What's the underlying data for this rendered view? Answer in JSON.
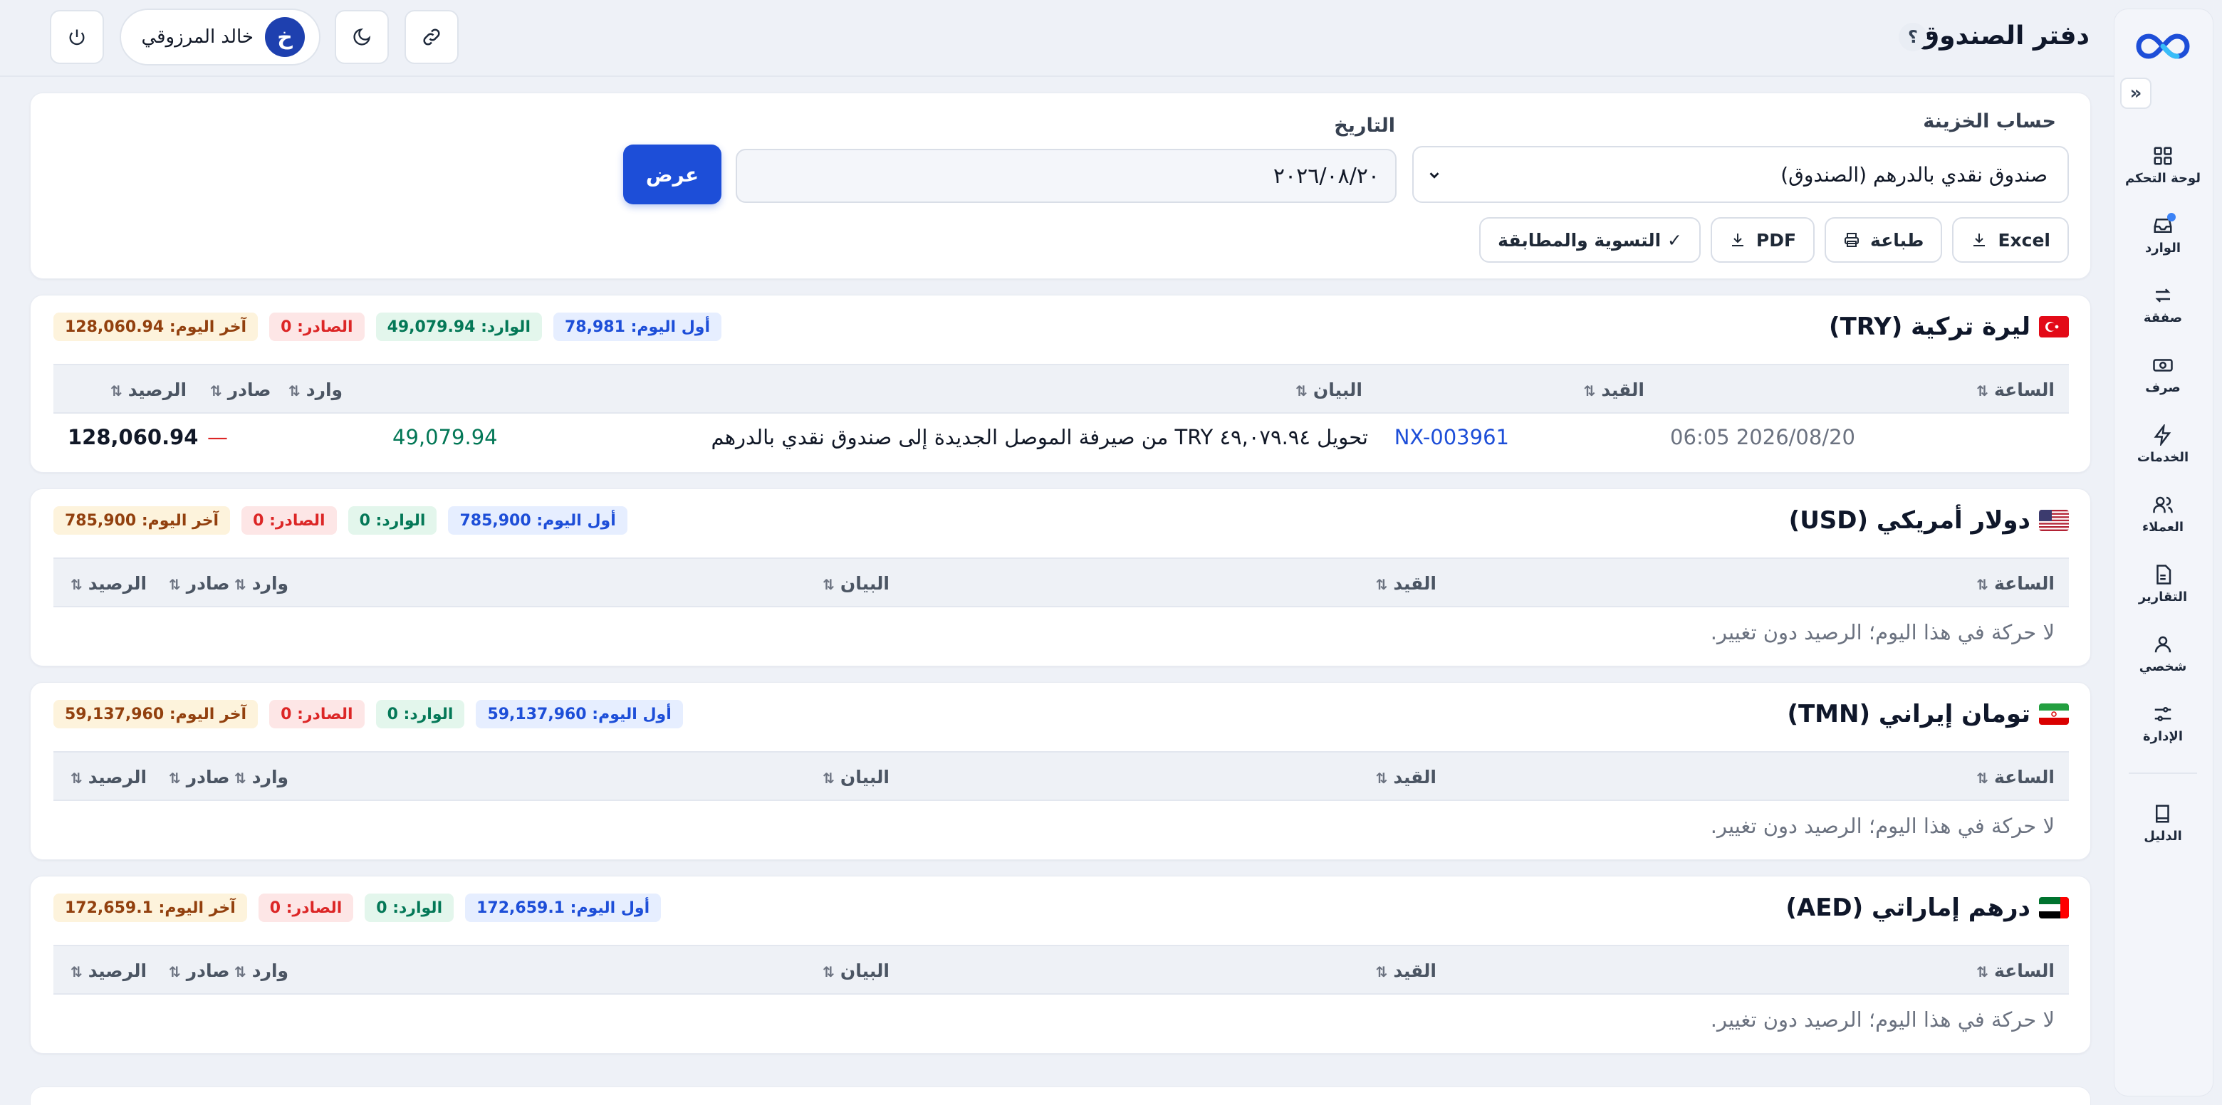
{
  "sidebar": {
    "items": [
      {
        "label": "لوحة التحكم",
        "icon": "dashboard-icon"
      },
      {
        "label": "الوارد",
        "icon": "inbox-icon"
      },
      {
        "label": "صفقة",
        "icon": "transfer-icon"
      },
      {
        "label": "صرف",
        "icon": "cash-icon"
      },
      {
        "label": "الخدمات",
        "icon": "bolt-icon"
      },
      {
        "label": "العملاء",
        "icon": "users-icon"
      },
      {
        "label": "التقارير",
        "icon": "report-icon"
      },
      {
        "label": "شخصي",
        "icon": "user-icon"
      },
      {
        "label": "الإدارة",
        "icon": "sliders-icon"
      }
    ],
    "guide_label": "الدليل"
  },
  "header": {
    "title": "دفتر الصندوق",
    "help": "؟",
    "user": {
      "name": "خالد المرزوقي",
      "initial": "خ"
    }
  },
  "filter": {
    "account_label": "حساب الخزينة",
    "account_value": "صندوق نقدي بالدرهم (الصندوق)",
    "date_label": "التاريخ",
    "date_value": "٢٠٢٦/٠٨/٢٠",
    "show_button": "عرض",
    "actions": [
      "Excel",
      "طباعة",
      "PDF",
      "✓ التسوية والمطابقة"
    ]
  },
  "table_headers": {
    "time": "الساعة",
    "entry": "القيد",
    "statement": "البيان",
    "incoming": "وارد",
    "outgoing": "صادر",
    "balance": "الرصيد"
  },
  "empty_message": "لا حركة في هذا اليوم؛ الرصيد دون تغيير.",
  "colors": {
    "primary": "#1d4ed8",
    "incoming": "#047857",
    "outgoing": "#dc2626",
    "opening": "#1d4ed8",
    "closing": "#92400e"
  },
  "sections": [
    {
      "title": "ليرة تركية (TRY)",
      "flag": "turkey-flag",
      "badges": {
        "opening": "أول اليوم: 78,981",
        "incoming": "الوارد: 49,079.94",
        "outgoing": "الصادر: 0",
        "closing": "آخر اليوم: 128,060.94"
      },
      "rows": [
        {
          "time": "2026/08/20 06:05",
          "entry": "NX-003961",
          "statement": "تحويل ٤٩,٠٧٩.٩٤ TRY من صيرفة الموصل الجديدة إلى صندوق نقدي بالدرهم",
          "incoming": "49,079.94",
          "outgoing": "—",
          "balance": "128,060.94"
        }
      ]
    },
    {
      "title": "دولار أمريكي (USD)",
      "flag": "usa-flag",
      "badges": {
        "opening": "أول اليوم: 785,900",
        "incoming": "الوارد: 0",
        "outgoing": "الصادر: 0",
        "closing": "آخر اليوم: 785,900"
      },
      "rows": []
    },
    {
      "title": "تومان إيراني (TMN)",
      "flag": "iran-flag",
      "badges": {
        "opening": "أول اليوم: 59,137,960",
        "incoming": "الوارد: 0",
        "outgoing": "الصادر: 0",
        "closing": "آخر اليوم: 59,137,960"
      },
      "rows": []
    },
    {
      "title": "درهم إماراتي (AED)",
      "flag": "uae-flag",
      "badges": {
        "opening": "أول اليوم: 172,659.1",
        "incoming": "الوارد: 0",
        "outgoing": "الصادر: 0",
        "closing": "آخر اليوم: 172,659.1"
      },
      "rows": []
    }
  ]
}
